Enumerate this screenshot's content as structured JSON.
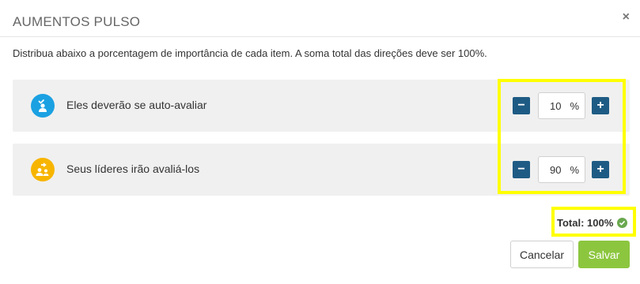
{
  "modal": {
    "title": "AUMENTOS PULSO",
    "close_label": "×",
    "description": "Distribua abaixo a porcentagem de importância de cada item. A soma total das direções deve ser 100%."
  },
  "items": [
    {
      "label": "Eles deverão se auto-avaliar",
      "value": "10",
      "unit": "%",
      "icon": "self-evaluation-icon",
      "icon_color": "#1ba1e2"
    },
    {
      "label": "Seus líderes irão avaliá-los",
      "value": "90",
      "unit": "%",
      "icon": "leaders-evaluation-icon",
      "icon_color": "#f7b500"
    }
  ],
  "stepper": {
    "minus_label": "−",
    "plus_label": "+"
  },
  "total": {
    "text": "Total: 100%",
    "status_color": "#6aa84f"
  },
  "footer": {
    "cancel_label": "Cancelar",
    "save_label": "Salvar"
  },
  "colors": {
    "accent": "#1e5b84",
    "save": "#8cc63f",
    "highlight": "#ffff00"
  }
}
